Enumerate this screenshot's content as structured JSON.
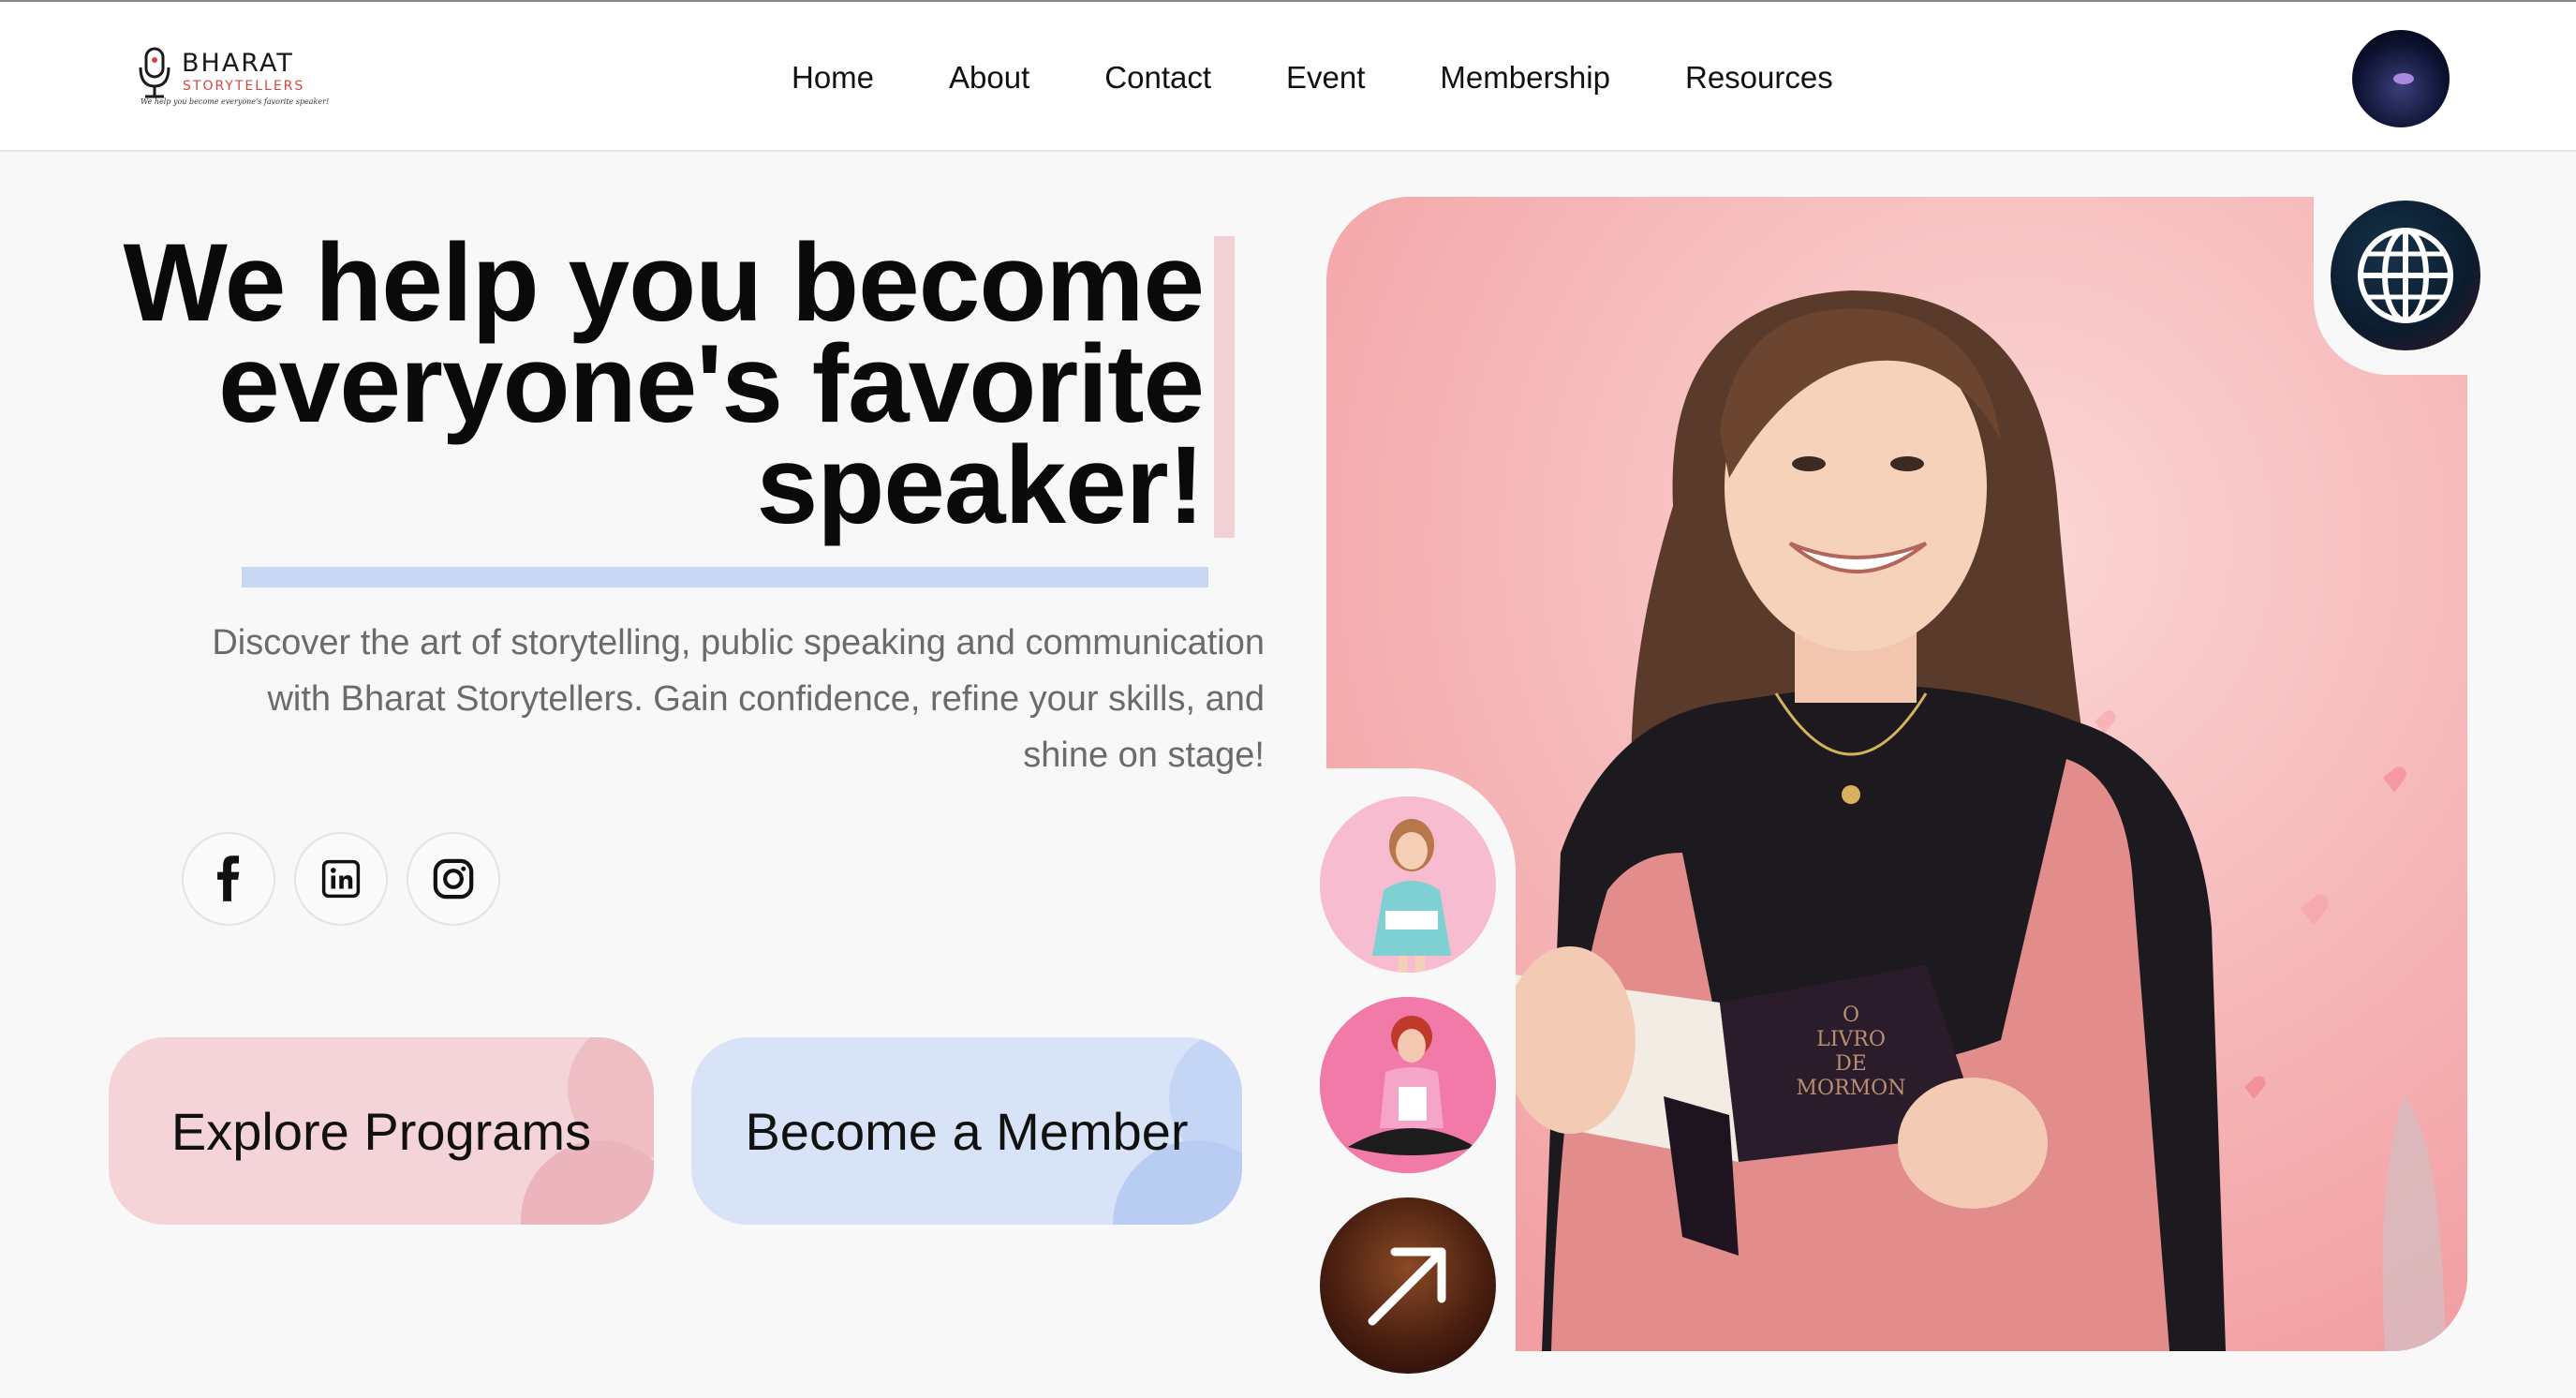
{
  "header": {
    "logo": {
      "brand": "BHARAT",
      "sub": "STORYTELLERS",
      "tagline": "We help you become everyone's favorite speaker!"
    },
    "nav": [
      {
        "label": "Home"
      },
      {
        "label": "About"
      },
      {
        "label": "Contact"
      },
      {
        "label": "Event"
      },
      {
        "label": "Membership"
      },
      {
        "label": "Resources"
      }
    ]
  },
  "hero": {
    "title_line1": "We help you become",
    "title_line2": "everyone's favorite",
    "title_line3": "speaker!",
    "description_line1": "Discover the art of storytelling, public speaking and communication",
    "description_line2": "with Bharat Storytellers. Gain confidence, refine your skills, and",
    "description_line3": "shine on stage!",
    "socials": [
      {
        "icon": "facebook-icon"
      },
      {
        "icon": "linkedin-icon"
      },
      {
        "icon": "instagram-icon"
      }
    ],
    "buttons": {
      "explore": "Explore Programs",
      "member": "Become a Member"
    }
  },
  "media": {
    "main_photo": "woman-holding-book",
    "book_text": [
      "O",
      "LIVRO",
      "DE",
      "MORMON"
    ],
    "thumbnails": [
      "girl-reading",
      "woman-meditating",
      "storyteller-arrow"
    ]
  },
  "colors": {
    "accent_pink": "#f5d4d9",
    "accent_blue": "#d8e3f8",
    "underline_blue": "#c8d8f4",
    "text_dark": "#0a0a0a",
    "text_muted": "#6b6b6b"
  }
}
